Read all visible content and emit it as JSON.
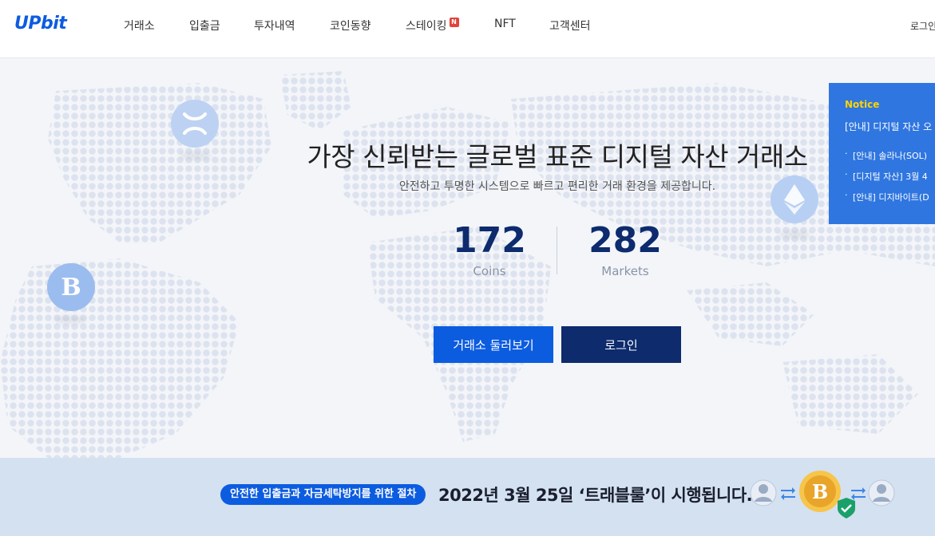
{
  "brand": {
    "logo": "UPbit",
    "accent": "#0c5ce0",
    "navy": "#0d2b6d"
  },
  "nav": {
    "items": [
      {
        "label": "거래소"
      },
      {
        "label": "입출금"
      },
      {
        "label": "투자내역"
      },
      {
        "label": "코인동향"
      },
      {
        "label": "스테이킹",
        "badge": "N"
      },
      {
        "label": "NFT"
      },
      {
        "label": "고객센터"
      }
    ],
    "login": "로그인"
  },
  "hero": {
    "title": "가장 신뢰받는 글로벌 표준 디지털 자산 거래소",
    "subtitle": "안전하고 투명한 시스템으로 빠르고 편리한 거래 환경을 제공합니다.",
    "stats": [
      {
        "value": "172",
        "label": "Coins"
      },
      {
        "value": "282",
        "label": "Markets"
      }
    ],
    "buttons": {
      "explore": "거래소 둘러보기",
      "login": "로그인"
    },
    "coins": [
      {
        "icon": "xrp-coin-icon"
      },
      {
        "icon": "ethereum-coin-icon"
      },
      {
        "icon": "bitcoin-coin-icon"
      }
    ]
  },
  "notice": {
    "label": "Notice",
    "headline": "[안내] 디지털 자산 오",
    "items": [
      "[안내] 솔라나(SOL)",
      "[디지털 자산] 3월 4",
      "[안내] 디지바이트(D"
    ]
  },
  "banner": {
    "pill": "안전한 입출금과 자금세탁방지를 위한 절차",
    "text": "2022년 3월 25일 ‘트래블룰’이 시행됩니다."
  }
}
